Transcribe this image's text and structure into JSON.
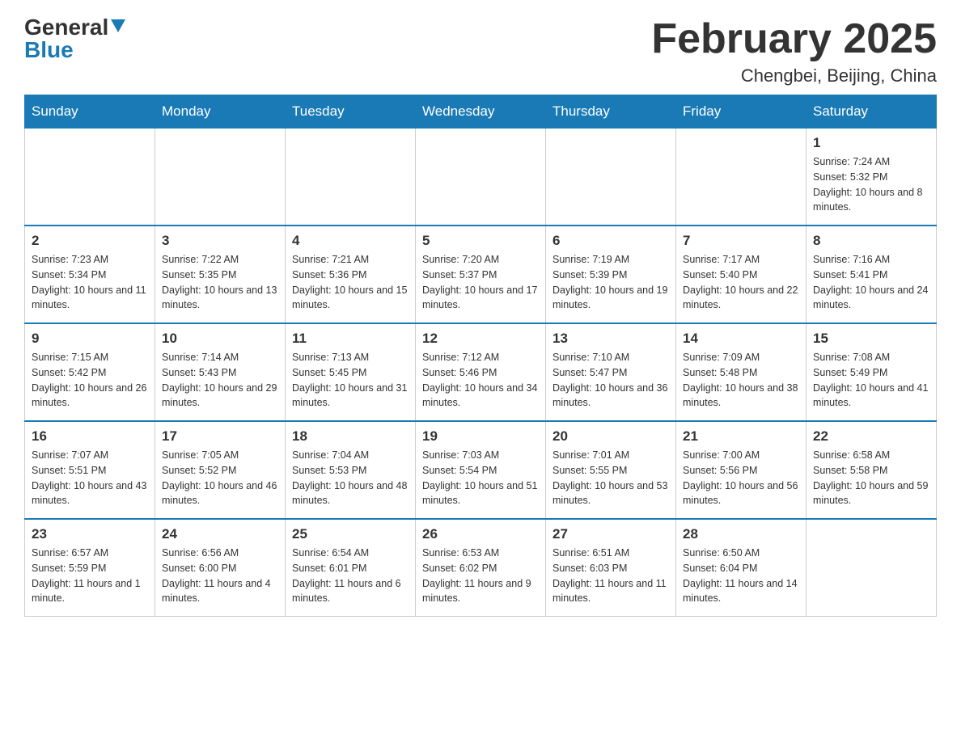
{
  "header": {
    "logo_general": "General",
    "logo_blue": "Blue",
    "month_title": "February 2025",
    "location": "Chengbei, Beijing, China"
  },
  "days_of_week": [
    "Sunday",
    "Monday",
    "Tuesday",
    "Wednesday",
    "Thursday",
    "Friday",
    "Saturday"
  ],
  "weeks": [
    {
      "days": [
        {
          "num": "",
          "info": ""
        },
        {
          "num": "",
          "info": ""
        },
        {
          "num": "",
          "info": ""
        },
        {
          "num": "",
          "info": ""
        },
        {
          "num": "",
          "info": ""
        },
        {
          "num": "",
          "info": ""
        },
        {
          "num": "1",
          "info": "Sunrise: 7:24 AM\nSunset: 5:32 PM\nDaylight: 10 hours and 8 minutes."
        }
      ]
    },
    {
      "days": [
        {
          "num": "2",
          "info": "Sunrise: 7:23 AM\nSunset: 5:34 PM\nDaylight: 10 hours and 11 minutes."
        },
        {
          "num": "3",
          "info": "Sunrise: 7:22 AM\nSunset: 5:35 PM\nDaylight: 10 hours and 13 minutes."
        },
        {
          "num": "4",
          "info": "Sunrise: 7:21 AM\nSunset: 5:36 PM\nDaylight: 10 hours and 15 minutes."
        },
        {
          "num": "5",
          "info": "Sunrise: 7:20 AM\nSunset: 5:37 PM\nDaylight: 10 hours and 17 minutes."
        },
        {
          "num": "6",
          "info": "Sunrise: 7:19 AM\nSunset: 5:39 PM\nDaylight: 10 hours and 19 minutes."
        },
        {
          "num": "7",
          "info": "Sunrise: 7:17 AM\nSunset: 5:40 PM\nDaylight: 10 hours and 22 minutes."
        },
        {
          "num": "8",
          "info": "Sunrise: 7:16 AM\nSunset: 5:41 PM\nDaylight: 10 hours and 24 minutes."
        }
      ]
    },
    {
      "days": [
        {
          "num": "9",
          "info": "Sunrise: 7:15 AM\nSunset: 5:42 PM\nDaylight: 10 hours and 26 minutes."
        },
        {
          "num": "10",
          "info": "Sunrise: 7:14 AM\nSunset: 5:43 PM\nDaylight: 10 hours and 29 minutes."
        },
        {
          "num": "11",
          "info": "Sunrise: 7:13 AM\nSunset: 5:45 PM\nDaylight: 10 hours and 31 minutes."
        },
        {
          "num": "12",
          "info": "Sunrise: 7:12 AM\nSunset: 5:46 PM\nDaylight: 10 hours and 34 minutes."
        },
        {
          "num": "13",
          "info": "Sunrise: 7:10 AM\nSunset: 5:47 PM\nDaylight: 10 hours and 36 minutes."
        },
        {
          "num": "14",
          "info": "Sunrise: 7:09 AM\nSunset: 5:48 PM\nDaylight: 10 hours and 38 minutes."
        },
        {
          "num": "15",
          "info": "Sunrise: 7:08 AM\nSunset: 5:49 PM\nDaylight: 10 hours and 41 minutes."
        }
      ]
    },
    {
      "days": [
        {
          "num": "16",
          "info": "Sunrise: 7:07 AM\nSunset: 5:51 PM\nDaylight: 10 hours and 43 minutes."
        },
        {
          "num": "17",
          "info": "Sunrise: 7:05 AM\nSunset: 5:52 PM\nDaylight: 10 hours and 46 minutes."
        },
        {
          "num": "18",
          "info": "Sunrise: 7:04 AM\nSunset: 5:53 PM\nDaylight: 10 hours and 48 minutes."
        },
        {
          "num": "19",
          "info": "Sunrise: 7:03 AM\nSunset: 5:54 PM\nDaylight: 10 hours and 51 minutes."
        },
        {
          "num": "20",
          "info": "Sunrise: 7:01 AM\nSunset: 5:55 PM\nDaylight: 10 hours and 53 minutes."
        },
        {
          "num": "21",
          "info": "Sunrise: 7:00 AM\nSunset: 5:56 PM\nDaylight: 10 hours and 56 minutes."
        },
        {
          "num": "22",
          "info": "Sunrise: 6:58 AM\nSunset: 5:58 PM\nDaylight: 10 hours and 59 minutes."
        }
      ]
    },
    {
      "days": [
        {
          "num": "23",
          "info": "Sunrise: 6:57 AM\nSunset: 5:59 PM\nDaylight: 11 hours and 1 minute."
        },
        {
          "num": "24",
          "info": "Sunrise: 6:56 AM\nSunset: 6:00 PM\nDaylight: 11 hours and 4 minutes."
        },
        {
          "num": "25",
          "info": "Sunrise: 6:54 AM\nSunset: 6:01 PM\nDaylight: 11 hours and 6 minutes."
        },
        {
          "num": "26",
          "info": "Sunrise: 6:53 AM\nSunset: 6:02 PM\nDaylight: 11 hours and 9 minutes."
        },
        {
          "num": "27",
          "info": "Sunrise: 6:51 AM\nSunset: 6:03 PM\nDaylight: 11 hours and 11 minutes."
        },
        {
          "num": "28",
          "info": "Sunrise: 6:50 AM\nSunset: 6:04 PM\nDaylight: 11 hours and 14 minutes."
        },
        {
          "num": "",
          "info": ""
        }
      ]
    }
  ]
}
